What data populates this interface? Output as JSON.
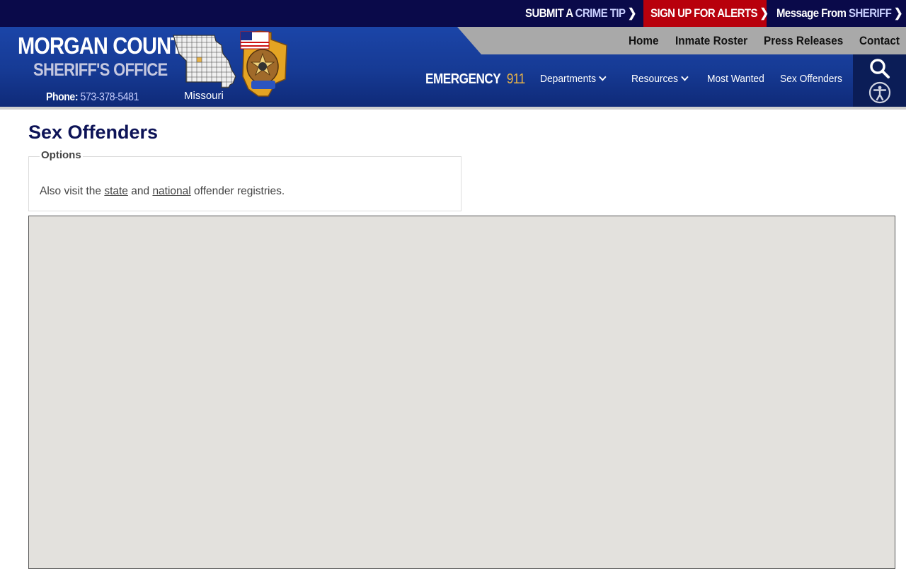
{
  "topbar": {
    "crime_tip": {
      "prefix": "SUBMIT A",
      "highlight": "CRIME TIP"
    },
    "alerts": {
      "label": "SIGN UP FOR ALERTS"
    },
    "sheriff": {
      "prefix": "Message From",
      "highlight": "SHERIFF"
    },
    "chevron": "❯"
  },
  "brand": {
    "line1": "MORGAN COUNTY",
    "line2": "SHERIFF'S OFFICE",
    "phone_label": "Phone:",
    "phone_number": "573-378-5481",
    "map_label": "Missouri"
  },
  "nav_top": [
    "Home",
    "Inmate Roster",
    "Press Releases",
    "Contact"
  ],
  "emergency": {
    "label": "EMERGENCY",
    "number": "911"
  },
  "nav_main": [
    {
      "label": "Departments",
      "dropdown": true
    },
    {
      "label": "Resources",
      "dropdown": true
    },
    {
      "label": "Most Wanted",
      "dropdown": false
    },
    {
      "label": "Sex Offenders",
      "dropdown": false
    }
  ],
  "icons": {
    "search": "search-icon",
    "accessibility": "accessibility-icon"
  },
  "page": {
    "title": "Sex Offenders",
    "options_legend": "Options",
    "visit_prefix": "Also visit the",
    "state_link": "state",
    "and_text": "and",
    "national_link": "national",
    "visit_suffix": "offender registries."
  },
  "colors": {
    "topbar": "#0a0a4a",
    "alerts_red": "#b8000c",
    "header_blue": "#1b45a8",
    "emergency_gold": "#e9b347",
    "title_navy": "#0d1357",
    "map_bg": "#e3e1dd"
  }
}
